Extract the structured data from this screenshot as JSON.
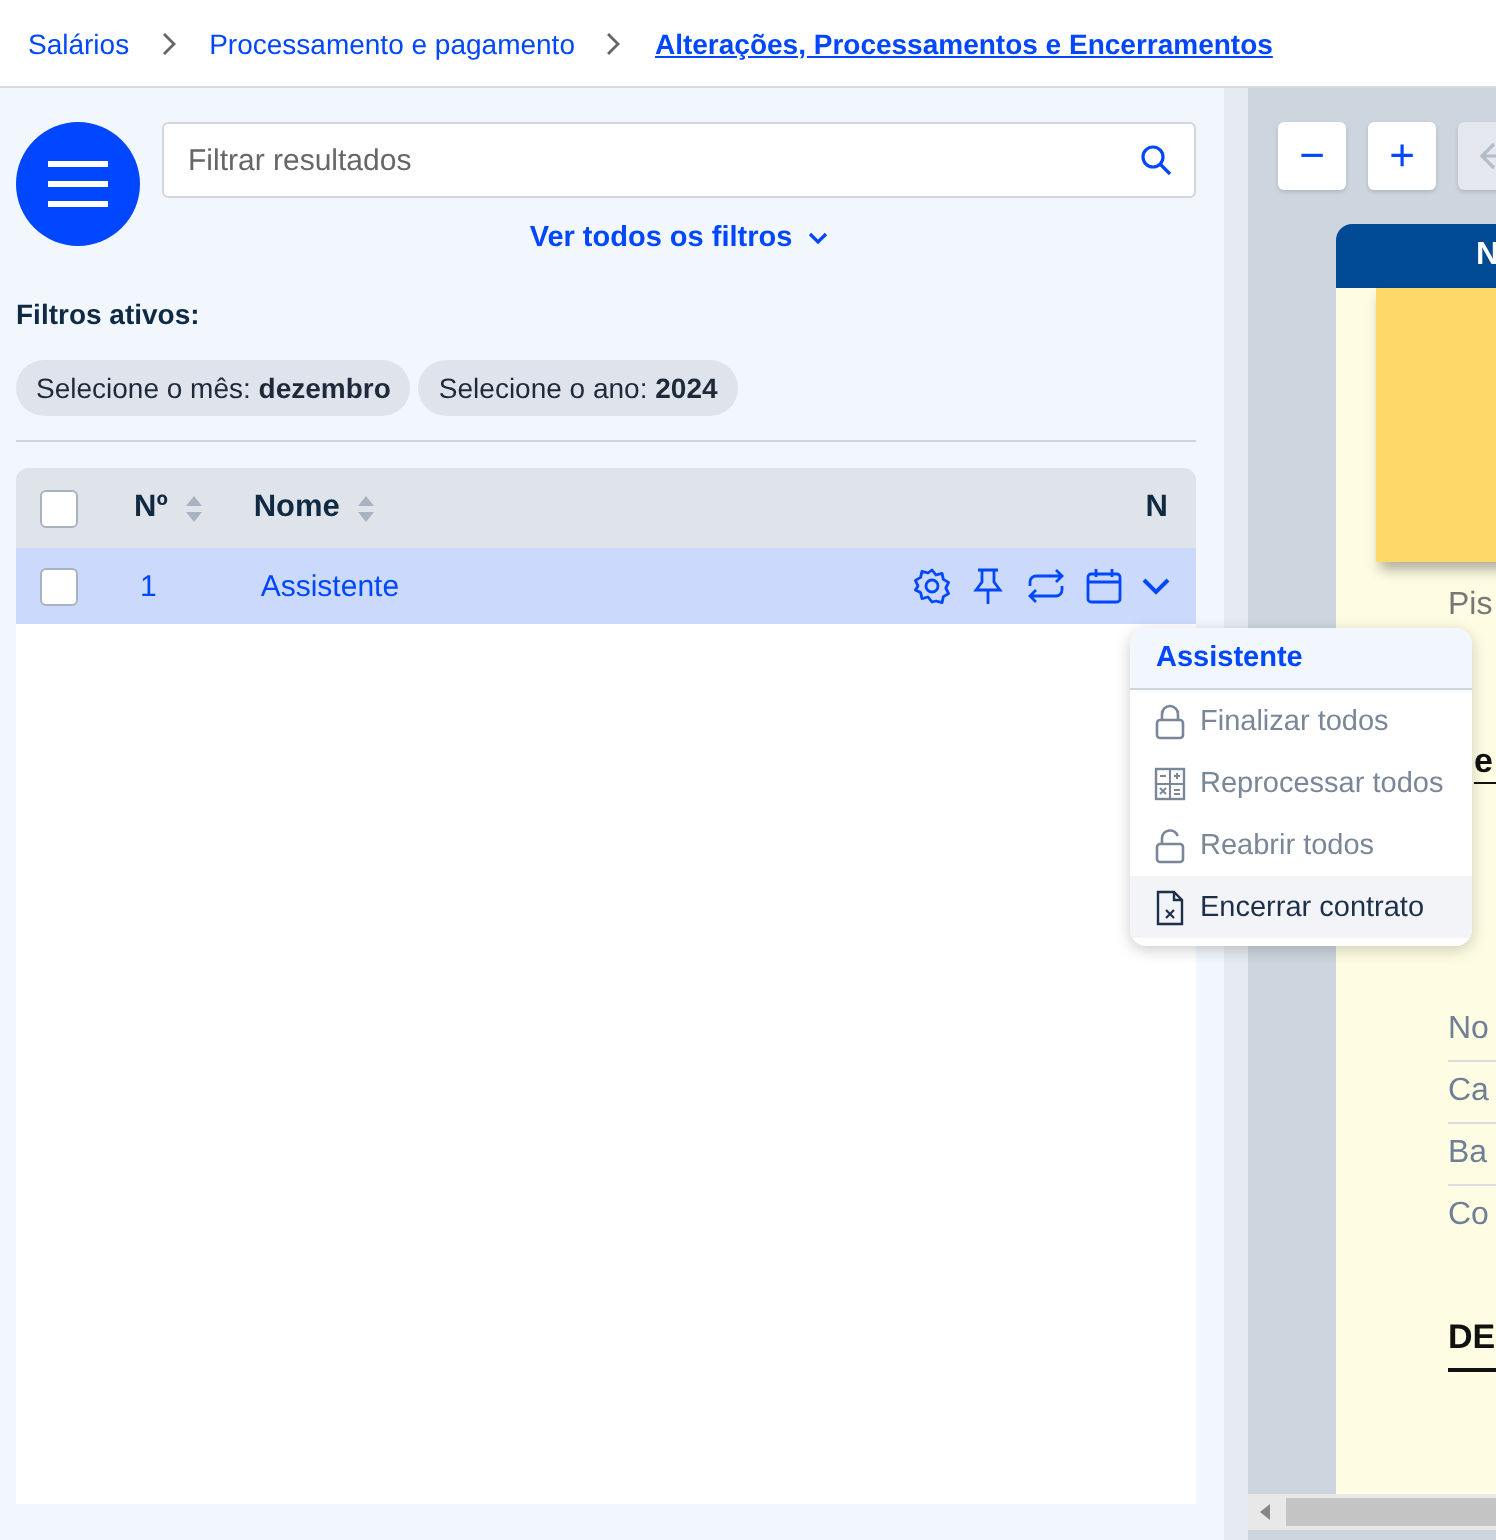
{
  "breadcrumb": [
    {
      "label": "Salários",
      "selected": false
    },
    {
      "label": "Processamento e pagamento",
      "selected": false
    },
    {
      "label": "Alterações, Processamentos e Encerramentos",
      "selected": true
    }
  ],
  "search": {
    "placeholder": "Filtrar resultados"
  },
  "filters_link": "Ver todos os filtros",
  "active_filters": {
    "title": "Filtros ativos:",
    "chips": [
      {
        "label": "Selecione o mês:",
        "value": "dezembro"
      },
      {
        "label": "Selecione o ano:",
        "value": "2024"
      }
    ]
  },
  "table": {
    "columns": [
      "Nº",
      "Nome",
      "N"
    ],
    "rows": [
      {
        "checked": false,
        "selected": true,
        "number": "1",
        "name": "Assistente"
      }
    ],
    "header_checked": false
  },
  "menu": {
    "title": "Assistente",
    "items": [
      {
        "kind": "lock",
        "label": "Finalizar todos",
        "disabled": true
      },
      {
        "kind": "calc",
        "label": "Reprocessar todos",
        "disabled": true
      },
      {
        "kind": "unlock",
        "label": "Reabrir todos",
        "disabled": true
      },
      {
        "kind": "file",
        "label": "Encerrar contrato",
        "disabled": false
      }
    ]
  },
  "preview": {
    "zoom_out": "−",
    "zoom_in": "+",
    "header": "N",
    "lines_top": [
      "Pis"
    ],
    "heading": "e",
    "fields": [
      "No",
      "Ca",
      "Ba",
      "Co"
    ],
    "section": "DE"
  }
}
